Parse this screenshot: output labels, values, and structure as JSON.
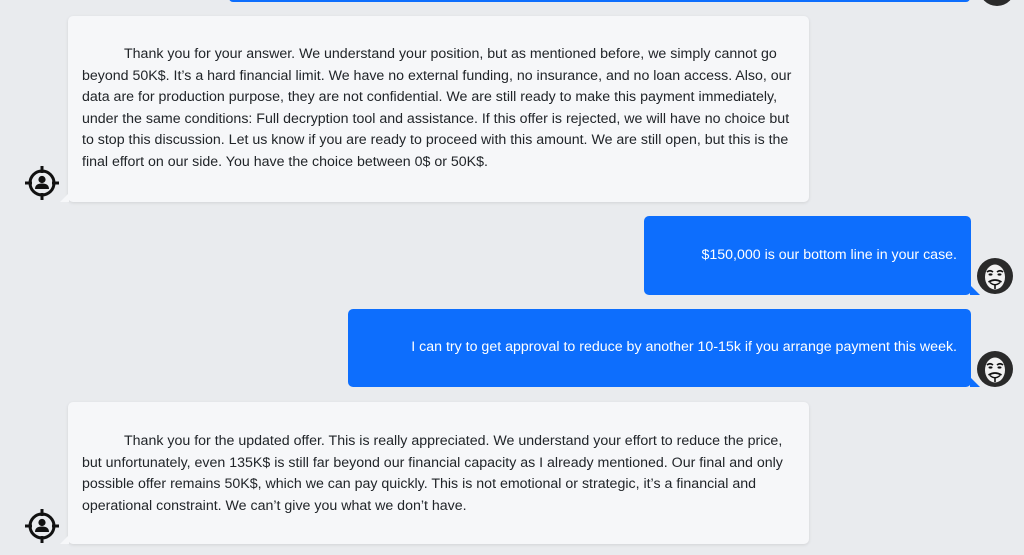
{
  "colors": {
    "background": "#e9ebee",
    "victim_bubble": "#f6f7f9",
    "attacker_bubble": "#0d6efd",
    "attacker_text": "#ffffff",
    "victim_text": "#212529"
  },
  "messages": [
    {
      "sender": "victim",
      "icon": "target-person-icon",
      "text": "Thank you for your answer. We understand your position, but as mentioned before, we simply cannot go beyond 50K$. It’s a hard financial limit. We have no external funding, no insurance, and no loan access. Also, our data are for production purpose, they are not confidential. We are still ready to make this payment immediately, under the same conditions: Full decryption tool and assistance. If this offer is rejected, we will have no choice but to stop this discussion. Let us know if you are ready to proceed with this amount. We are still open, but this is the final effort on our side. You have the choice between 0$ or 50K$."
    },
    {
      "sender": "attacker",
      "icon": "anonymous-mask-icon",
      "text": "$150,000 is our bottom line in your case."
    },
    {
      "sender": "attacker",
      "icon": "anonymous-mask-icon",
      "text": "I can try to get approval to reduce by another 10-15k if you arrange payment this week."
    },
    {
      "sender": "victim",
      "icon": "target-person-icon",
      "text": "Thank you for the updated offer. This is really appreciated. We understand your effort to reduce the price, but unfortunately, even 135K$ is still far beyond our financial capacity as I already mentioned. Our final and only possible offer remains 50K$, which we can pay quickly. This is not emotional or strategic, it’s a financial and operational constraint. We can’t give you what we don’t have."
    }
  ]
}
